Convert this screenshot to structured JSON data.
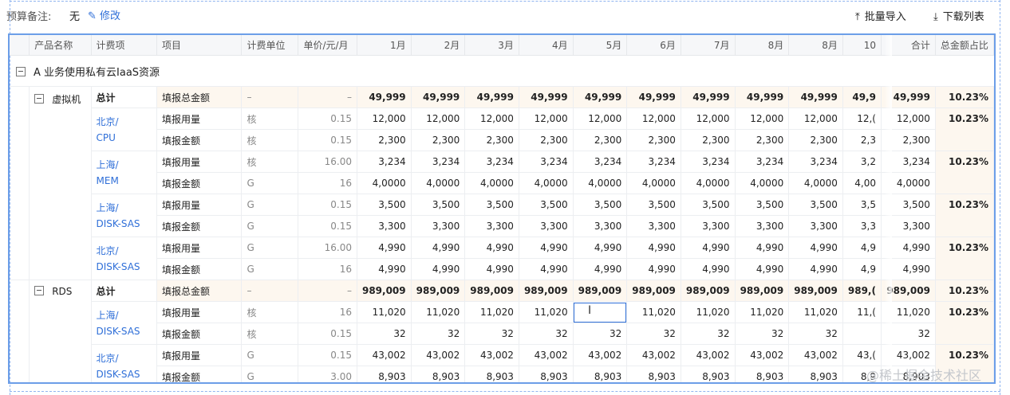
{
  "budget_note": {
    "label": "预算备注:",
    "value": "无",
    "edit_label": "修改",
    "edit_icon": "pencil-icon"
  },
  "actions": {
    "import_label": "批量导入",
    "import_icon": "upload-icon",
    "export_label": "下载列表",
    "export_icon": "download-icon"
  },
  "columns": [
    "产品名称",
    "计费项",
    "项目",
    "计费单位",
    "单价/元/月",
    "1月",
    "2月",
    "3月",
    "4月",
    "5月",
    "6月",
    "7月",
    "8月",
    "8月",
    "10",
    "合计",
    "总金额占比"
  ],
  "section": {
    "label": "A  业务使用私有云IaaS资源"
  },
  "products": [
    {
      "name": "虚拟机",
      "total": {
        "label": "总计",
        "item": "填报总金额",
        "unit": "–",
        "price": "–",
        "months": [
          "49,999",
          "49,999",
          "49,999",
          "49,999",
          "49,999",
          "49,999",
          "49,999",
          "49,999",
          "49,999",
          "49,9"
        ],
        "sum": "49,999",
        "pct": "10.23%"
      },
      "groups": [
        {
          "region": "北京/",
          "spec": "CPU",
          "pct": "10.23%",
          "rows": [
            {
              "item": "填报用量",
              "unit": "核",
              "price": "0.15",
              "months": [
                "12,000",
                "12,000",
                "12,000",
                "12,000",
                "12,000",
                "12,000",
                "12,000",
                "12,000",
                "12,000",
                "12,("
              ],
              "sum": "12,000"
            },
            {
              "item": "填报金额",
              "unit": "核",
              "price": "0.15",
              "months": [
                "2,300",
                "2,300",
                "2,300",
                "2,300",
                "2,300",
                "2,300",
                "2,300",
                "2,300",
                "2,300",
                "2,3"
              ],
              "sum": "2,300"
            }
          ]
        },
        {
          "region": "上海/",
          "spec": "MEM",
          "pct": "10.23%",
          "rows": [
            {
              "item": "填报用量",
              "unit": "核",
              "price": "16.00",
              "months": [
                "3,234",
                "3,234",
                "3,234",
                "3,234",
                "3,234",
                "3,234",
                "3,234",
                "3,234",
                "3,234",
                "3,2"
              ],
              "sum": "3,234"
            },
            {
              "item": "填报金额",
              "unit": "G",
              "price": "16",
              "months": [
                "4,0000",
                "4,0000",
                "4,0000",
                "4,0000",
                "4,0000",
                "4,0000",
                "4,0000",
                "4,0000",
                "4,0000",
                "4,00"
              ],
              "sum": "4,0000"
            }
          ]
        },
        {
          "region": "上海/",
          "spec": "DISK-SAS",
          "pct": "10.23%",
          "rows": [
            {
              "item": "填报用量",
              "unit": "G",
              "price": "0.15",
              "months": [
                "3,500",
                "3,500",
                "3,500",
                "3,500",
                "3,500",
                "3,500",
                "3,500",
                "3,500",
                "3,500",
                "3,5"
              ],
              "sum": "3,500"
            },
            {
              "item": "填报金额",
              "unit": "G",
              "price": "0.15",
              "months": [
                "3,300",
                "3,300",
                "3,300",
                "3,300",
                "3,300",
                "3,300",
                "3,300",
                "3,300",
                "3,300",
                "3,3"
              ],
              "sum": "3,300"
            }
          ]
        },
        {
          "region": "北京/",
          "spec": "DISK-SAS",
          "pct": "10.23%",
          "rows": [
            {
              "item": "填报用量",
              "unit": "G",
              "price": "16.00",
              "months": [
                "4,990",
                "4,990",
                "4,990",
                "4,990",
                "4,990",
                "4,990",
                "4,990",
                "4,990",
                "4,990",
                "4,9"
              ],
              "sum": "4,990"
            },
            {
              "item": "填报金额",
              "unit": "G",
              "price": "16",
              "months": [
                "4,990",
                "4,990",
                "4,990",
                "4,990",
                "4,990",
                "4,990",
                "4,990",
                "4,990",
                "4,990",
                "4,9"
              ],
              "sum": "4,990"
            }
          ]
        }
      ]
    },
    {
      "name": "RDS",
      "total": {
        "label": "总计",
        "item": "填报总金额",
        "unit": "–",
        "price": "–",
        "months": [
          "989,009",
          "989,009",
          "989,009",
          "989,009",
          "989,009",
          "989,009",
          "989,009",
          "989,009",
          "989,009",
          "989,("
        ],
        "sum": "989,009",
        "pct": "10.23%"
      },
      "groups": [
        {
          "region": "上海/",
          "spec": "DISK-SAS",
          "pct": "10.23%",
          "rows": [
            {
              "item": "填报用量",
              "unit": "核",
              "price": "16",
              "months": [
                "11,020",
                "11,020",
                "11,020",
                "11,020",
                "",
                "11,020",
                "11,020",
                "11,020",
                "11,020",
                "11,("
              ],
              "sum": "11,020"
            },
            {
              "item": "填报金额",
              "unit": "核",
              "price": "0.15",
              "months": [
                "32",
                "32",
                "32",
                "32",
                "32",
                "32",
                "32",
                "32",
                "32",
                ""
              ],
              "sum": "32"
            }
          ]
        },
        {
          "region": "北京/",
          "spec": "DISK-SAS",
          "pct": "10.23%",
          "rows": [
            {
              "item": "填报用量",
              "unit": "G",
              "price": "0.15",
              "months": [
                "43,002",
                "43,002",
                "43,002",
                "43,002",
                "43,002",
                "43,002",
                "43,002",
                "43,002",
                "43,002",
                "43,("
              ],
              "sum": "43,002"
            },
            {
              "item": "填报金额",
              "unit": "G",
              "price": "3.00",
              "months": [
                "8,903",
                "8,903",
                "8,903",
                "8,903",
                "8,903",
                "8,903",
                "8,903",
                "8,903",
                "8,903",
                "8,9"
              ],
              "sum": "8,903"
            }
          ]
        }
      ]
    }
  ],
  "watermark": "@稀土掘金技术社区"
}
